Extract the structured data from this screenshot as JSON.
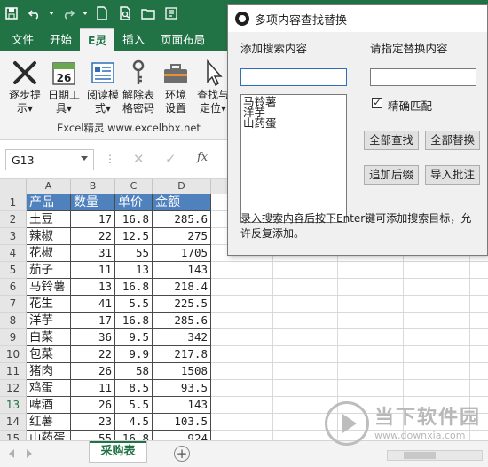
{
  "ribbon": {
    "tabs": [
      "文件",
      "开始",
      "E灵",
      "插入",
      "页面布局"
    ],
    "active_tab": "E灵",
    "buttons": [
      {
        "l1": "逐步提",
        "l2": "示▾"
      },
      {
        "l1": "日期工",
        "l2": "具▾"
      },
      {
        "l1": "阅读模",
        "l2": "式▾"
      },
      {
        "l1": "解除表",
        "l2": "格密码"
      },
      {
        "l1": "环境",
        "l2": "设置"
      },
      {
        "l1": "查找与",
        "l2": "定位▾"
      }
    ],
    "calendar_day": "26",
    "group_label": "Excel精灵   www.excelbbx.net"
  },
  "formula_bar": {
    "name_box": "G13",
    "fx_label": "fx",
    "cancel_glyph": "✕",
    "confirm_glyph": "✓",
    "dots": "⋮"
  },
  "sheet": {
    "columns": [
      "A",
      "B",
      "C",
      "D"
    ],
    "header": [
      "产品",
      "数量",
      "单价",
      "金额"
    ],
    "rows": [
      [
        "土豆",
        "17",
        "16.8",
        "285.6"
      ],
      [
        "辣椒",
        "22",
        "12.5",
        "275"
      ],
      [
        "花椒",
        "31",
        "55",
        "1705"
      ],
      [
        "茄子",
        "11",
        "13",
        "143"
      ],
      [
        "马铃薯",
        "13",
        "16.8",
        "218.4"
      ],
      [
        "花生",
        "41",
        "5.5",
        "225.5"
      ],
      [
        "洋芋",
        "17",
        "16.8",
        "285.6"
      ],
      [
        "白菜",
        "36",
        "9.5",
        "342"
      ],
      [
        "包菜",
        "22",
        "9.9",
        "217.8"
      ],
      [
        "猪肉",
        "26",
        "58",
        "1508"
      ],
      [
        "鸡蛋",
        "11",
        "8.5",
        "93.5"
      ],
      [
        "啤酒",
        "26",
        "5.5",
        "143"
      ],
      [
        "红薯",
        "23",
        "4.5",
        "103.5"
      ],
      [
        "山药蛋",
        "55",
        "16.8",
        "924"
      ]
    ],
    "row_numbers": [
      "1",
      "2",
      "3",
      "4",
      "5",
      "6",
      "7",
      "8",
      "9",
      "10",
      "11",
      "12",
      "13",
      "14",
      "15"
    ],
    "tab_name": "采购表",
    "add_sheet": "+",
    "colors": {
      "header_fill": "#4f81bd",
      "brand": "#217346"
    }
  },
  "dialog": {
    "title": "多项内容查找替换",
    "search_label": "添加搜索内容",
    "replace_label": "请指定替换内容",
    "search_value": "",
    "replace_value": "",
    "list_items": [
      "马铃薯",
      "洋芋",
      "山药蛋"
    ],
    "exact_match_label": "精确匹配",
    "exact_match_checked": true,
    "check_glyph": "✓",
    "find_all": "全部查找",
    "replace_all": "全部替换",
    "append_suffix": "追加后缀",
    "import_comment": "导入批注",
    "note": "录入搜索内容后按下Enter键可添加搜索目标，允许反复添加。"
  },
  "watermark": {
    "name": "当下软件园",
    "url": "www.downxia.com"
  }
}
